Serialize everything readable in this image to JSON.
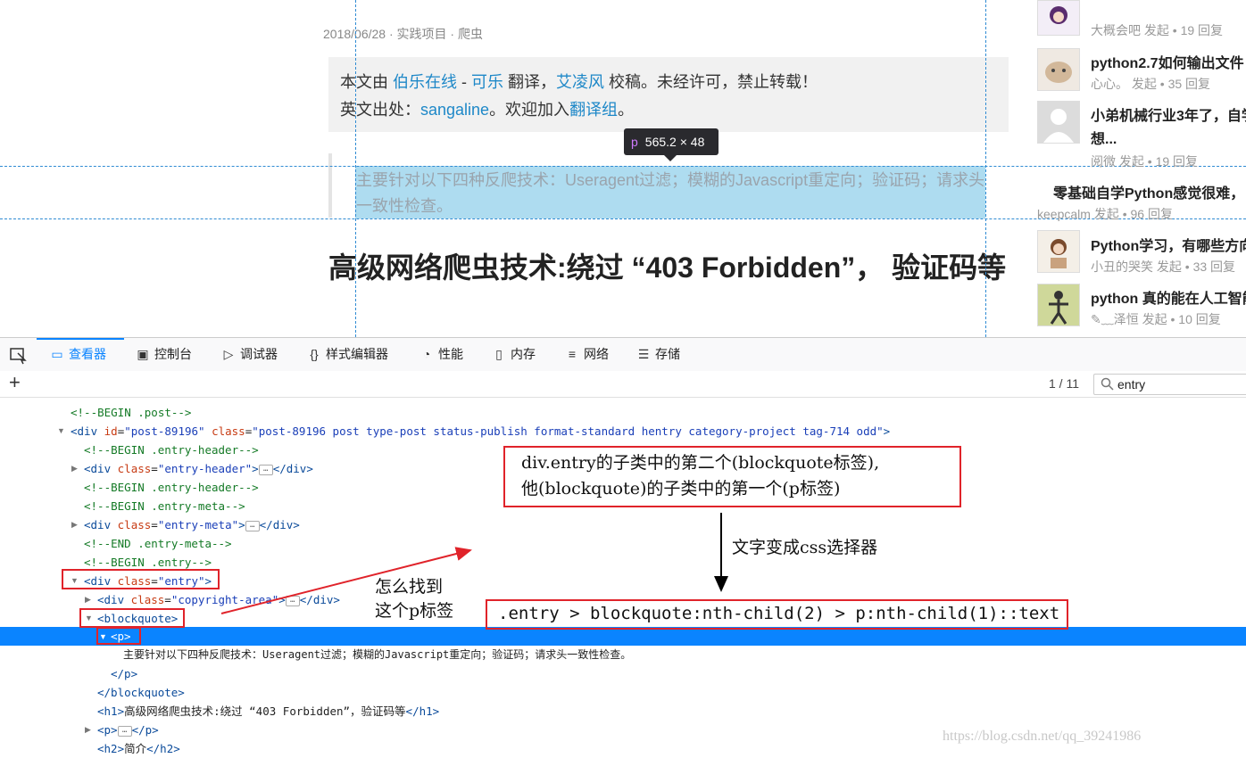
{
  "page": {
    "meta": "2018/06/28 · 实践项目 · 爬虫",
    "copyright": {
      "l1_prefix": "本文由 ",
      "l1_link1": "伯乐在线",
      "l1_sep": " - ",
      "l1_link2": "可乐",
      "l1_mid": " 翻译，",
      "l1_link3": "艾凌风",
      "l1_suffix": " 校稿。未经许可，禁止转载！",
      "l2_prefix": "英文出处：",
      "l2_link1": "sangaline",
      "l2_mid": "。欢迎加入",
      "l2_link2": "翻译组",
      "l2_suffix": "。"
    },
    "tooltip_tag": "p",
    "tooltip_size": "565.2 × 48",
    "quote": "主要针对以下四种反爬技术：Useragent过滤；模糊的Javascript重定向；验证码；请求头一致性检查。",
    "title": "高级网络爬虫技术:绕过 “403 Forbidden”， 验证码等"
  },
  "sidebar": [
    {
      "title": "",
      "sub": "大概会吧 发起 • 19 回复"
    },
    {
      "title": "python2.7如何输出文件",
      "sub": "心心。 发起 • 35 回复"
    },
    {
      "title": "小弟机械行业3年了，自学",
      "title2": "想...",
      "sub": "阅微 发起 • 19 回复"
    },
    {
      "title": "零基础自学Python感觉很难，",
      "sub": "keepcalm 发起 • 96 回复"
    },
    {
      "title": "Python学习，有哪些方向",
      "sub": "小丑的哭笑 发起 • 33 回复"
    },
    {
      "title": "python 真的能在人工智能",
      "sub": "✎﹏泽恒 发起 • 10 回复"
    }
  ],
  "devtools": {
    "tabs": [
      {
        "label": "查看器",
        "icon": "inspector-icon"
      },
      {
        "label": "控制台",
        "icon": "console-icon"
      },
      {
        "label": "调试器",
        "icon": "debugger-icon"
      },
      {
        "label": "样式编辑器",
        "icon": "style-editor-icon"
      },
      {
        "label": "性能",
        "icon": "performance-icon"
      },
      {
        "label": "内存",
        "icon": "memory-icon"
      },
      {
        "label": "网络",
        "icon": "network-icon"
      },
      {
        "label": "存储",
        "icon": "storage-icon"
      }
    ],
    "search_count": "1 / 11",
    "search_value": "entry",
    "code": {
      "l0": "<!--BEGIN .post-->",
      "l1_open": "<div ",
      "l1_id_attr": "id",
      "l1_id_val": "\"post-89196\"",
      "l1_class_attr": " class",
      "l1_class_val": "\"post-89196 post type-post status-publish format-standard hentry category-project tag-714 odd\"",
      "l1_close": ">",
      "l2": "<!--BEGIN .entry-header-->",
      "l3_open": "<div ",
      "l3_attr": "class",
      "l3_val": "\"entry-header\"",
      "l3_close": "</div>",
      "l4": "<!--BEGIN .entry-header-->",
      "l5": "<!--BEGIN .entry-meta-->",
      "l6_open": "<div ",
      "l6_attr": "class",
      "l6_val": "\"entry-meta\"",
      "l6_close": "</div>",
      "l7": "<!--END .entry-meta-->",
      "l8": "<!--BEGIN .entry-->",
      "l9_open": "<div ",
      "l9_attr": "class",
      "l9_val": "\"entry\"",
      "l9_close": ">",
      "l10_open": "<div ",
      "l10_attr": "class",
      "l10_val": "\"copyright-area\"",
      "l10_close": "</div>",
      "l11": "<blockquote>",
      "l12": "<p>",
      "l13": "主要针对以下四种反爬技术：Useragent过滤；模糊的Javascript重定向；验证码；请求头一致性检查。",
      "l14": "</p>",
      "l15": "</blockquote>",
      "l16_open": "<h1>",
      "l16_text": "高级网络爬虫技术:绕过 “403 Forbidden”，验证码等",
      "l16_close": "</h1>",
      "l17_open": "<p>",
      "l17_close": "</p>",
      "l18_open": "<h2>",
      "l18_text": "简介",
      "l18_close": "</h2>"
    }
  },
  "annotations": {
    "box1_line1": "div.entry的子类中的第二个(blockquote标签),",
    "box1_line2": "他(blockquote)的子类中的第一个(p标签)",
    "arrow_label": "文字变成css选择器",
    "question_line1": "怎么找到",
    "question_line2": "这个p标签",
    "selector": ".entry > blockquote:nth-child(2) > p:nth-child(1)::text",
    "accent_color": "#e0232a"
  },
  "watermark": "https://blog.csdn.net/qq_39241986"
}
